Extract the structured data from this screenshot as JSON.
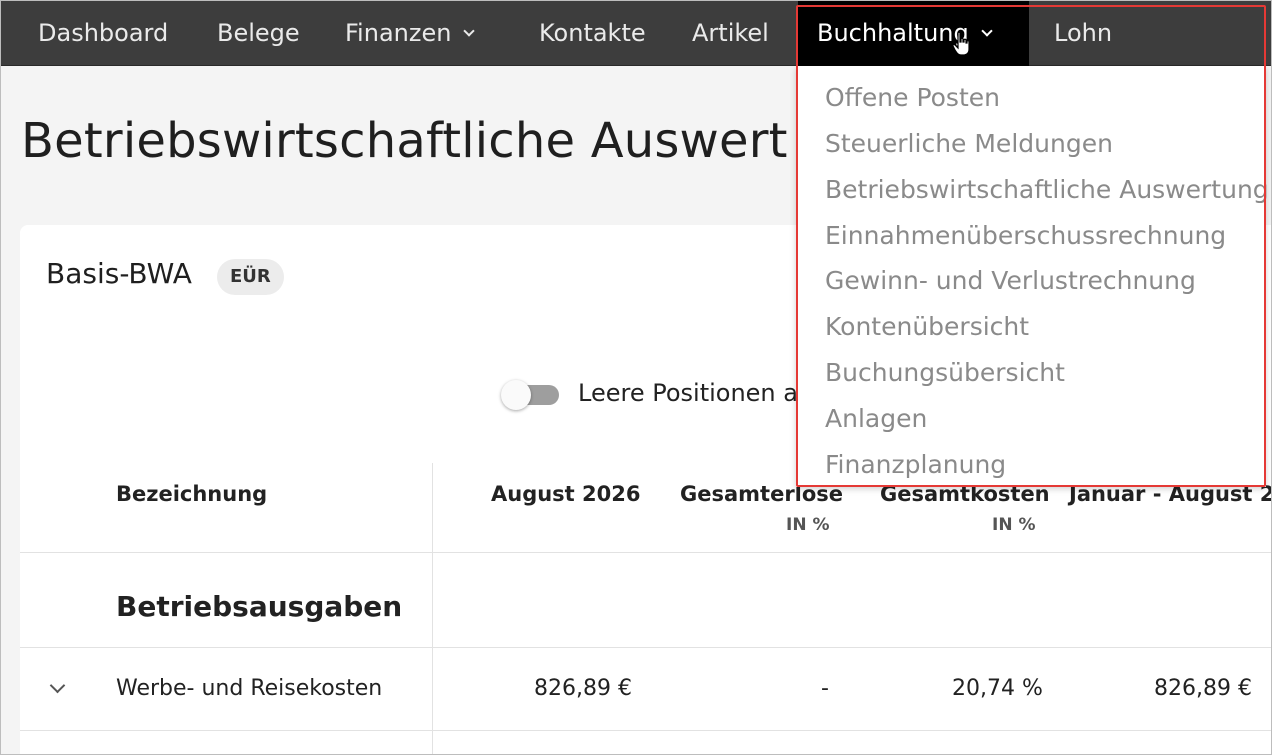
{
  "nav": {
    "items": [
      {
        "label": "Dashboard"
      },
      {
        "label": "Belege"
      },
      {
        "label": "Finanzen"
      },
      {
        "label": "Kontakte"
      },
      {
        "label": "Artikel"
      },
      {
        "label": "Buchhaltung"
      },
      {
        "label": "Lohn"
      }
    ]
  },
  "page": {
    "title": "Betriebswirtschaftliche Auswert"
  },
  "card": {
    "title": "Basis-BWA",
    "badge": "EÜR",
    "toggle_label": "Leere Positionen a",
    "toggle_on": false
  },
  "table": {
    "headers": [
      {
        "label": "Bezeichnung",
        "sub": ""
      },
      {
        "label": "August 2026",
        "sub": ""
      },
      {
        "label": "Gesamterlöse",
        "sub": "IN %"
      },
      {
        "label": "Gesamtkosten",
        "sub": "IN %"
      },
      {
        "label": "Januar - August 2",
        "sub": ""
      }
    ],
    "section": "Betriebsausgaben",
    "rows": [
      {
        "label": "Werbe- und Reisekosten",
        "month": "826,89 €",
        "erloese_pct": "-",
        "kosten_pct": "20,74 %",
        "ytd": "826,89 €"
      }
    ]
  },
  "dropdown": {
    "items": [
      {
        "label": "Offene Posten"
      },
      {
        "label": "Steuerliche Meldungen"
      },
      {
        "label": "Betriebswirtschaftliche Auswertung"
      },
      {
        "label": "Einnahmenüberschussrechnung"
      },
      {
        "label": "Gewinn- und Verlustrechnung"
      },
      {
        "label": "Kontenübersicht"
      },
      {
        "label": "Buchungsübersicht"
      },
      {
        "label": "Anlagen"
      },
      {
        "label": "Finanzplanung"
      }
    ]
  },
  "colors": {
    "nav_bg": "#3d3d3d",
    "nav_active_bg": "#000000",
    "highlight": "#e53935",
    "dropdown_text": "#8a8a8a"
  }
}
